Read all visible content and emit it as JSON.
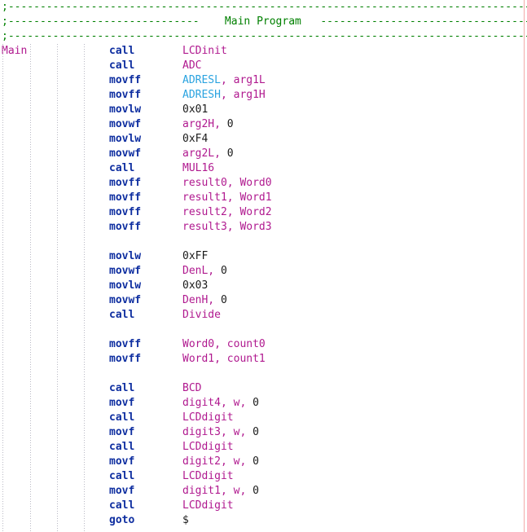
{
  "editor": {
    "language": "pic-assembly",
    "font_size_px": 13,
    "line_height_px": 18,
    "background": "#ffffff",
    "colors": {
      "comment": "#008000",
      "label": "#b0198f",
      "mnemonic": "#0e2ea0",
      "symbol": "#b0198f",
      "special_register": "#2aa3e0",
      "literal": "#1a1a1a",
      "indent_guide": "#b9b9c4",
      "margin_rule": "#f4a9a9"
    },
    "indent_guides_x": [
      3,
      37,
      70,
      103
    ],
    "margin_rule_x": 643
  },
  "header": {
    "rule_top": ";--------------------------------------------------------------------------------------------",
    "title_line_prefix": ";------------------------------",
    "title": "Main Program",
    "title_line_suffix": "--------------------------------------------",
    "rule_bottom": ";--------------------------------------------------------------------------------------------"
  },
  "lines": [
    {
      "n": 1,
      "type": "comment",
      "text": ";--------------------------------------------------------------------------------------------"
    },
    {
      "n": 2,
      "type": "comment",
      "text": ";------------------------------    Main Program   --------------------------------------------"
    },
    {
      "n": 3,
      "type": "comment",
      "text": ";--------------------------------------------------------------------------------------------"
    },
    {
      "n": 4,
      "type": "code",
      "label": "Main",
      "mnemonic": "call",
      "operand": [
        {
          "t": "LCDinit",
          "k": "symbol"
        }
      ]
    },
    {
      "n": 5,
      "type": "code",
      "label": "",
      "mnemonic": "call",
      "operand": [
        {
          "t": "ADC",
          "k": "symbol"
        }
      ]
    },
    {
      "n": 6,
      "type": "code",
      "label": "",
      "mnemonic": "movff",
      "operand": [
        {
          "t": "ADRESL",
          "k": "sfr"
        },
        {
          "t": ", ",
          "k": "symbol"
        },
        {
          "t": "arg1L",
          "k": "symbol"
        }
      ]
    },
    {
      "n": 7,
      "type": "code",
      "label": "",
      "mnemonic": "movff",
      "operand": [
        {
          "t": "ADRESH",
          "k": "sfr"
        },
        {
          "t": ", ",
          "k": "symbol"
        },
        {
          "t": "arg1H",
          "k": "symbol"
        }
      ]
    },
    {
      "n": 8,
      "type": "code",
      "label": "",
      "mnemonic": "movlw",
      "operand": [
        {
          "t": "0x01",
          "k": "plain"
        }
      ]
    },
    {
      "n": 9,
      "type": "code",
      "label": "",
      "mnemonic": "movwf",
      "operand": [
        {
          "t": "arg2H,",
          "k": "symbol"
        },
        {
          "t": " 0",
          "k": "plain"
        }
      ]
    },
    {
      "n": 10,
      "type": "code",
      "label": "",
      "mnemonic": "movlw",
      "operand": [
        {
          "t": "0xF4",
          "k": "plain"
        }
      ]
    },
    {
      "n": 11,
      "type": "code",
      "label": "",
      "mnemonic": "movwf",
      "operand": [
        {
          "t": "arg2L,",
          "k": "symbol"
        },
        {
          "t": " 0",
          "k": "plain"
        }
      ]
    },
    {
      "n": 12,
      "type": "code",
      "label": "",
      "mnemonic": "call",
      "operand": [
        {
          "t": "MUL16",
          "k": "symbol"
        }
      ]
    },
    {
      "n": 13,
      "type": "code",
      "label": "",
      "mnemonic": "movff",
      "operand": [
        {
          "t": "result0, Word0",
          "k": "symbol"
        }
      ]
    },
    {
      "n": 14,
      "type": "code",
      "label": "",
      "mnemonic": "movff",
      "operand": [
        {
          "t": "result1, Word1",
          "k": "symbol"
        }
      ]
    },
    {
      "n": 15,
      "type": "code",
      "label": "",
      "mnemonic": "movff",
      "operand": [
        {
          "t": "result2, Word2",
          "k": "symbol"
        }
      ]
    },
    {
      "n": 16,
      "type": "code",
      "label": "",
      "mnemonic": "movff",
      "operand": [
        {
          "t": "result3, Word3",
          "k": "symbol"
        }
      ]
    },
    {
      "n": 17,
      "type": "blank"
    },
    {
      "n": 18,
      "type": "code",
      "label": "",
      "mnemonic": "movlw",
      "operand": [
        {
          "t": "0xFF",
          "k": "plain"
        }
      ]
    },
    {
      "n": 19,
      "type": "code",
      "label": "",
      "mnemonic": "movwf",
      "operand": [
        {
          "t": "DenL,",
          "k": "symbol"
        },
        {
          "t": " 0",
          "k": "plain"
        }
      ]
    },
    {
      "n": 20,
      "type": "code",
      "label": "",
      "mnemonic": "movlw",
      "operand": [
        {
          "t": "0x03",
          "k": "plain"
        }
      ]
    },
    {
      "n": 21,
      "type": "code",
      "label": "",
      "mnemonic": "movwf",
      "operand": [
        {
          "t": "DenH,",
          "k": "symbol"
        },
        {
          "t": " 0",
          "k": "plain"
        }
      ]
    },
    {
      "n": 22,
      "type": "code",
      "label": "",
      "mnemonic": "call",
      "operand": [
        {
          "t": "Divide",
          "k": "symbol"
        }
      ]
    },
    {
      "n": 23,
      "type": "blank"
    },
    {
      "n": 24,
      "type": "code",
      "label": "",
      "mnemonic": "movff",
      "operand": [
        {
          "t": "Word0, count0",
          "k": "symbol"
        }
      ]
    },
    {
      "n": 25,
      "type": "code",
      "label": "",
      "mnemonic": "movff",
      "operand": [
        {
          "t": "Word1, count1",
          "k": "symbol"
        }
      ]
    },
    {
      "n": 26,
      "type": "blank"
    },
    {
      "n": 27,
      "type": "code",
      "label": "",
      "mnemonic": "call",
      "operand": [
        {
          "t": "BCD",
          "k": "symbol"
        }
      ]
    },
    {
      "n": 28,
      "type": "code",
      "label": "",
      "mnemonic": "movf",
      "operand": [
        {
          "t": "digit4, w,",
          "k": "symbol"
        },
        {
          "t": " 0",
          "k": "plain"
        }
      ]
    },
    {
      "n": 29,
      "type": "code",
      "label": "",
      "mnemonic": "call",
      "operand": [
        {
          "t": "LCDdigit",
          "k": "symbol"
        }
      ]
    },
    {
      "n": 30,
      "type": "code",
      "label": "",
      "mnemonic": "movf",
      "operand": [
        {
          "t": "digit3, w,",
          "k": "symbol"
        },
        {
          "t": " 0",
          "k": "plain"
        }
      ]
    },
    {
      "n": 31,
      "type": "code",
      "label": "",
      "mnemonic": "call",
      "operand": [
        {
          "t": "LCDdigit",
          "k": "symbol"
        }
      ]
    },
    {
      "n": 32,
      "type": "code",
      "label": "",
      "mnemonic": "movf",
      "operand": [
        {
          "t": "digit2, w,",
          "k": "symbol"
        },
        {
          "t": " 0",
          "k": "plain"
        }
      ]
    },
    {
      "n": 33,
      "type": "code",
      "label": "",
      "mnemonic": "call",
      "operand": [
        {
          "t": "LCDdigit",
          "k": "symbol"
        }
      ]
    },
    {
      "n": 34,
      "type": "code",
      "label": "",
      "mnemonic": "movf",
      "operand": [
        {
          "t": "digit1, w,",
          "k": "symbol"
        },
        {
          "t": " 0",
          "k": "plain"
        }
      ]
    },
    {
      "n": 35,
      "type": "code",
      "label": "",
      "mnemonic": "call",
      "operand": [
        {
          "t": "LCDdigit",
          "k": "symbol"
        }
      ]
    },
    {
      "n": 36,
      "type": "code",
      "label": "",
      "mnemonic": "goto",
      "operand": [
        {
          "t": "$",
          "k": "plain"
        }
      ]
    }
  ]
}
